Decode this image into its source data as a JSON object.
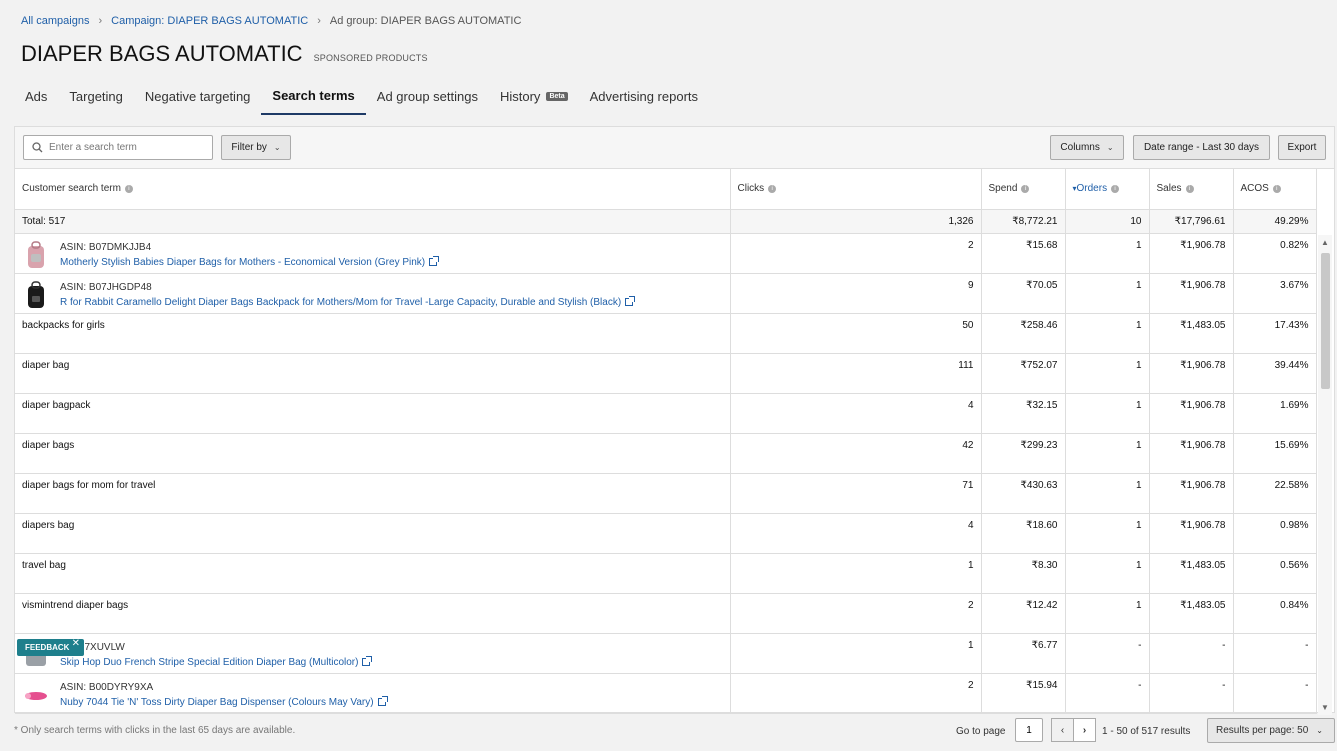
{
  "breadcrumb": {
    "all_campaigns": "All campaigns",
    "campaign": "Campaign: DIAPER BAGS AUTOMATIC",
    "ad_group": "Ad group: DIAPER BAGS AUTOMATIC"
  },
  "page": {
    "title": "DIAPER BAGS AUTOMATIC",
    "subtitle": "SPONSORED PRODUCTS"
  },
  "tabs": [
    {
      "label": "Ads"
    },
    {
      "label": "Targeting"
    },
    {
      "label": "Negative targeting"
    },
    {
      "label": "Search terms"
    },
    {
      "label": "Ad group settings"
    },
    {
      "label": "History"
    },
    {
      "label": "Advertising reports"
    }
  ],
  "tab_badge": "Beta",
  "toolbar": {
    "search_placeholder": "Enter a search term",
    "filter_label": "Filter by",
    "columns_label": "Columns",
    "date_range_label": "Date range - Last 30 days",
    "export_label": "Export"
  },
  "columns": {
    "search_term": "Customer search term",
    "clicks": "Clicks",
    "spend": "Spend",
    "orders": "Orders",
    "sales": "Sales",
    "acos": "ACOS"
  },
  "total": {
    "label": "Total: 517",
    "clicks": "1,326",
    "spend": "₹8,772.21",
    "orders": "10",
    "sales": "₹17,796.61",
    "acos": "49.29%"
  },
  "rows": [
    {
      "term": "",
      "asin": "ASIN: B07DMKJJB4",
      "product": "Motherly Stylish Babies Diaper Bags for Mothers - Economical Version (Grey Pink)",
      "clicks": "2",
      "spend": "₹15.68",
      "orders": "1",
      "sales": "₹1,906.78",
      "acos": "0.82%"
    },
    {
      "term": "",
      "asin": "ASIN: B07JHGDP48",
      "product": "R for Rabbit Caramello Delight Diaper Bags Backpack for Mothers/Mom for Travel -Large Capacity, Durable and Stylish (Black)",
      "clicks": "9",
      "spend": "₹70.05",
      "orders": "1",
      "sales": "₹1,906.78",
      "acos": "3.67%"
    },
    {
      "term": "backpacks for girls",
      "clicks": "50",
      "spend": "₹258.46",
      "orders": "1",
      "sales": "₹1,483.05",
      "acos": "17.43%"
    },
    {
      "term": "diaper bag",
      "clicks": "111",
      "spend": "₹752.07",
      "orders": "1",
      "sales": "₹1,906.78",
      "acos": "39.44%"
    },
    {
      "term": "diaper bagpack",
      "clicks": "4",
      "spend": "₹32.15",
      "orders": "1",
      "sales": "₹1,906.78",
      "acos": "1.69%"
    },
    {
      "term": "diaper bags",
      "clicks": "42",
      "spend": "₹299.23",
      "orders": "1",
      "sales": "₹1,906.78",
      "acos": "15.69%"
    },
    {
      "term": "diaper bags for mom for travel",
      "clicks": "71",
      "spend": "₹430.63",
      "orders": "1",
      "sales": "₹1,906.78",
      "acos": "22.58%"
    },
    {
      "term": "diapers bag",
      "clicks": "4",
      "spend": "₹18.60",
      "orders": "1",
      "sales": "₹1,906.78",
      "acos": "0.98%"
    },
    {
      "term": "travel bag",
      "clicks": "1",
      "spend": "₹8.30",
      "orders": "1",
      "sales": "₹1,483.05",
      "acos": "0.56%"
    },
    {
      "term": "vismintrend diaper bags",
      "clicks": "2",
      "spend": "₹12.42",
      "orders": "1",
      "sales": "₹1,483.05",
      "acos": "0.84%"
    },
    {
      "term": "",
      "asin": "B00B7XUVLW",
      "product": "Skip Hop Duo French Stripe Special Edition Diaper Bag (Multicolor)",
      "clicks": "1",
      "spend": "₹6.77",
      "orders": "-",
      "sales": "-",
      "acos": "-"
    },
    {
      "term": "",
      "asin": "ASIN: B00DYRY9XA",
      "product": "Nuby 7044 Tie 'N' Toss Dirty Diaper Bag Dispenser (Colours May Vary)",
      "clicks": "2",
      "spend": "₹15.94",
      "orders": "-",
      "sales": "-",
      "acos": "-"
    }
  ],
  "feedback_label": "FEEDBACK",
  "footer": {
    "note": "* Only search terms with clicks in the last 65 days are available.",
    "goto_label": "Go to page",
    "page_value": "1",
    "results": "1 - 50 of 517 results",
    "per_page": "Results per page: 50"
  },
  "colors": {
    "link": "#1f5fa8",
    "tab_underline": "#1e3a66",
    "feedback": "#1e7f8c"
  }
}
